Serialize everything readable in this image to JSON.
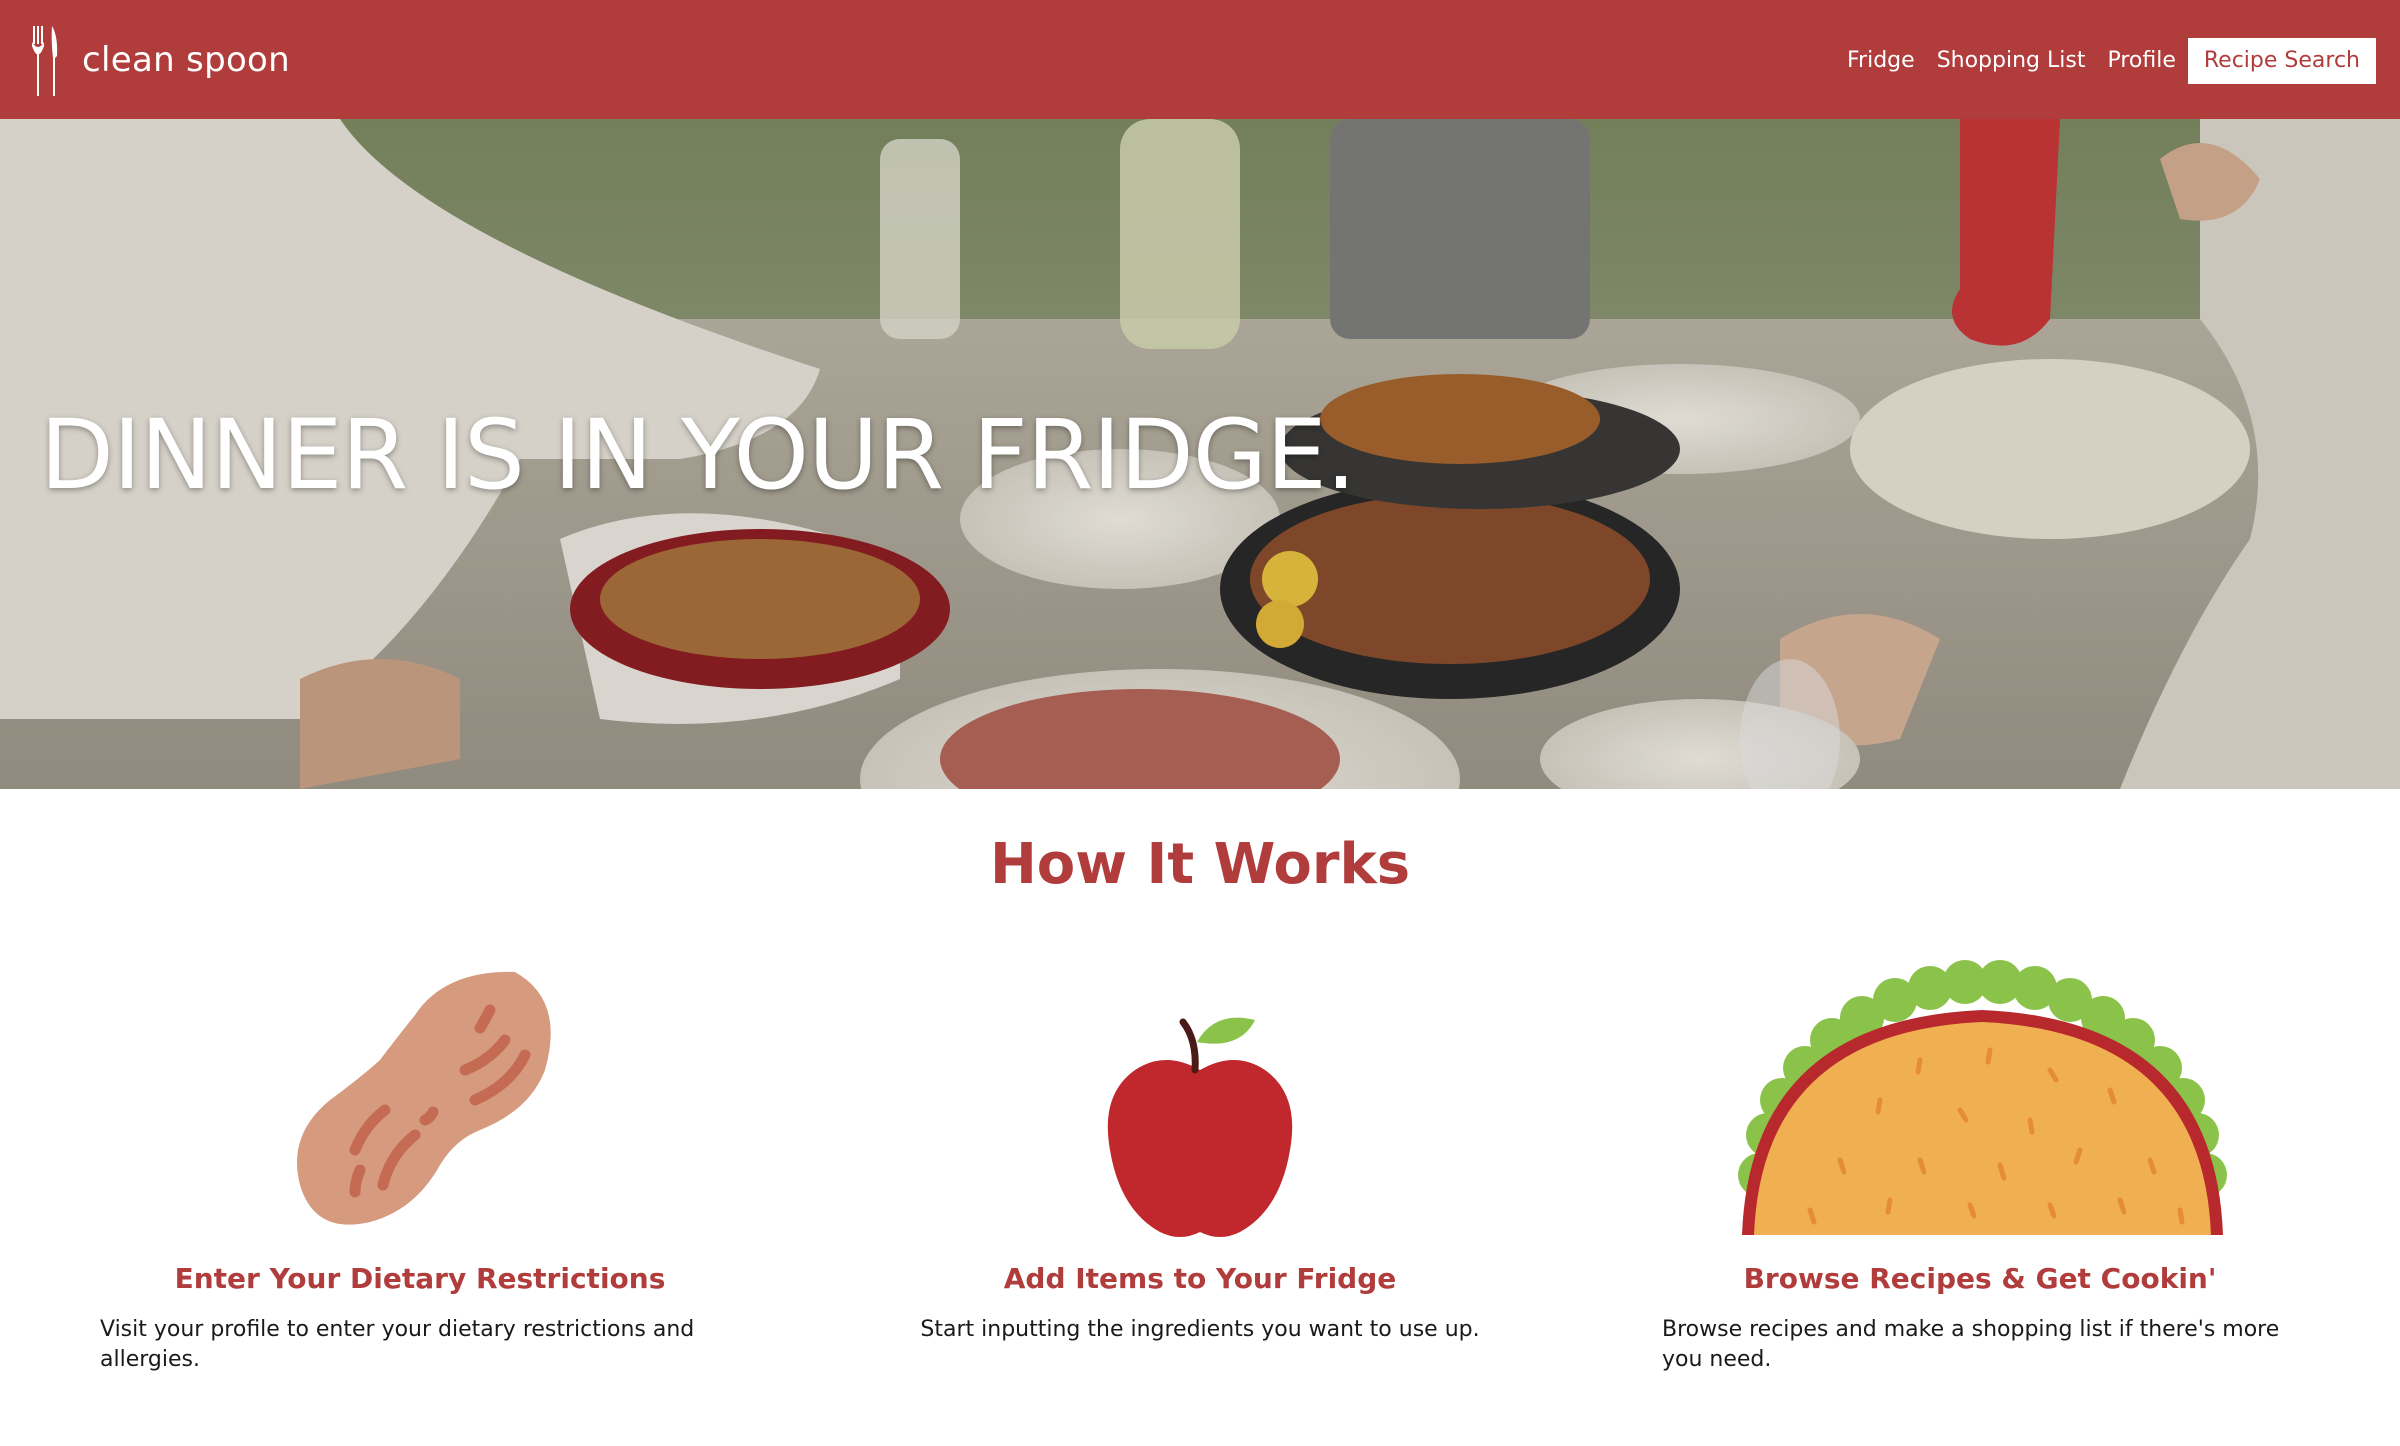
{
  "header": {
    "brand_name": "clean spoon",
    "brand_icon": "fork-knife-icon",
    "nav": [
      {
        "label": "Fridge"
      },
      {
        "label": "Shopping List"
      },
      {
        "label": "Profile"
      },
      {
        "label": "Recipe Search"
      }
    ],
    "bg_color": "#b03c3c"
  },
  "hero": {
    "title": "DINNER IS IN YOUR FRIDGE."
  },
  "how": {
    "title": "How It Works",
    "steps": [
      {
        "icon": "peanut-icon",
        "title": "Enter Your Dietary Restrictions",
        "description": "Visit your profile to enter your dietary restrictions and allergies."
      },
      {
        "icon": "apple-icon",
        "title": "Add Items to Your Fridge",
        "description": "Start inputting the ingredients you want to use up."
      },
      {
        "icon": "taco-icon",
        "title": "Browse Recipes & Get Cookin'",
        "description": "Browse recipes and make a shopping list if there's more you need."
      }
    ]
  }
}
